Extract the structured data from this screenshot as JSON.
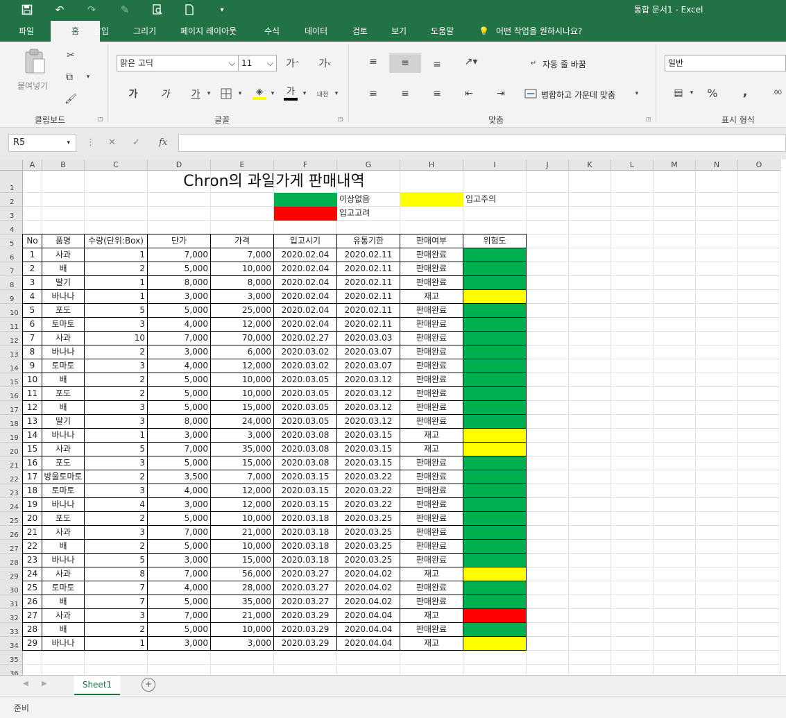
{
  "window": {
    "title": "통합 문서1  -  Excel"
  },
  "tabs": [
    "파일",
    "홈",
    "삽입",
    "그리기",
    "페이지 레이아웃",
    "수식",
    "데이터",
    "검토",
    "보기",
    "도움말"
  ],
  "tell_me": "어떤 작업을 원하시나요?",
  "ribbon": {
    "paste_label": "붙여넣기",
    "clipboard_group": "클립보드",
    "font_name": "맑은 고딕",
    "font_size": "11",
    "font_group": "글꼴",
    "wrap_text": "자동 줄 바꿈",
    "merge_center": "병합하고 가운데 맞춤",
    "align_group": "맞춤",
    "number_format": "일반",
    "number_group": "표시 형식",
    "bold_glyph": "가",
    "italic_glyph": "가",
    "underline_glyph": "가",
    "grow_glyph": "가",
    "shrink_glyph": "가",
    "phonetic_glyph": "내천",
    "font_color_glyph": "가",
    "percent_glyph": "%",
    "comma_glyph": ","
  },
  "formula_bar": {
    "name_box": "R5",
    "fx": "fx",
    "formula": ""
  },
  "columns": [
    "A",
    "B",
    "C",
    "D",
    "E",
    "F",
    "G",
    "H",
    "I",
    "J",
    "K",
    "L",
    "M",
    "N",
    "O"
  ],
  "rows_visible": 36,
  "sheet": {
    "title": "Chron의 과일가게 판매내역",
    "legend": {
      "ok_label": "이상없음",
      "caution_label": "입고주의",
      "consider_label": "입고고려",
      "ok_color": "#00b050",
      "caution_color": "#ffff00",
      "consider_color": "#ff0000"
    },
    "headers": [
      "No",
      "품명",
      "수량(단위:Box)",
      "단가",
      "가격",
      "입고시기",
      "유통기한",
      "판매여부",
      "위험도"
    ],
    "rows": [
      [
        "1",
        "사과",
        "1",
        "7,000",
        "7,000",
        "2020.02.04",
        "2020.02.11",
        "판매완료",
        "green"
      ],
      [
        "2",
        "배",
        "2",
        "5,000",
        "10,000",
        "2020.02.04",
        "2020.02.11",
        "판매완료",
        "green"
      ],
      [
        "3",
        "딸기",
        "1",
        "8,000",
        "8,000",
        "2020.02.04",
        "2020.02.11",
        "판매완료",
        "green"
      ],
      [
        "4",
        "바나나",
        "1",
        "3,000",
        "3,000",
        "2020.02.04",
        "2020.02.11",
        "재고",
        "yellow"
      ],
      [
        "5",
        "포도",
        "5",
        "5,000",
        "25,000",
        "2020.02.04",
        "2020.02.11",
        "판매완료",
        "green"
      ],
      [
        "6",
        "토마토",
        "3",
        "4,000",
        "12,000",
        "2020.02.04",
        "2020.02.11",
        "판매완료",
        "green"
      ],
      [
        "7",
        "사과",
        "10",
        "7,000",
        "70,000",
        "2020.02.27",
        "2020.03.03",
        "판매완료",
        "green"
      ],
      [
        "8",
        "바나나",
        "2",
        "3,000",
        "6,000",
        "2020.03.02",
        "2020.03.07",
        "판매완료",
        "green"
      ],
      [
        "9",
        "토마토",
        "3",
        "4,000",
        "12,000",
        "2020.03.02",
        "2020.03.07",
        "판매완료",
        "green"
      ],
      [
        "10",
        "배",
        "2",
        "5,000",
        "10,000",
        "2020.03.05",
        "2020.03.12",
        "판매완료",
        "green"
      ],
      [
        "11",
        "포도",
        "2",
        "5,000",
        "10,000",
        "2020.03.05",
        "2020.03.12",
        "판매완료",
        "green"
      ],
      [
        "12",
        "배",
        "3",
        "5,000",
        "15,000",
        "2020.03.05",
        "2020.03.12",
        "판매완료",
        "green"
      ],
      [
        "13",
        "딸기",
        "3",
        "8,000",
        "24,000",
        "2020.03.05",
        "2020.03.12",
        "판매완료",
        "green"
      ],
      [
        "14",
        "바나나",
        "1",
        "3,000",
        "3,000",
        "2020.03.08",
        "2020.03.15",
        "재고",
        "yellow"
      ],
      [
        "15",
        "사과",
        "5",
        "7,000",
        "35,000",
        "2020.03.08",
        "2020.03.15",
        "재고",
        "yellow"
      ],
      [
        "16",
        "포도",
        "3",
        "5,000",
        "15,000",
        "2020.03.08",
        "2020.03.15",
        "판매완료",
        "green"
      ],
      [
        "17",
        "방울토마토",
        "2",
        "3,500",
        "7,000",
        "2020.03.15",
        "2020.03.22",
        "판매완료",
        "green"
      ],
      [
        "18",
        "토마토",
        "3",
        "4,000",
        "12,000",
        "2020.03.15",
        "2020.03.22",
        "판매완료",
        "green"
      ],
      [
        "19",
        "바나나",
        "4",
        "3,000",
        "12,000",
        "2020.03.15",
        "2020.03.22",
        "판매완료",
        "green"
      ],
      [
        "20",
        "포도",
        "2",
        "5,000",
        "10,000",
        "2020.03.18",
        "2020.03.25",
        "판매완료",
        "green"
      ],
      [
        "21",
        "사과",
        "3",
        "7,000",
        "21,000",
        "2020.03.18",
        "2020.03.25",
        "판매완료",
        "green"
      ],
      [
        "22",
        "배",
        "2",
        "5,000",
        "10,000",
        "2020.03.18",
        "2020.03.25",
        "판매완료",
        "green"
      ],
      [
        "23",
        "바나나",
        "5",
        "3,000",
        "15,000",
        "2020.03.18",
        "2020.03.25",
        "판매완료",
        "green"
      ],
      [
        "24",
        "사과",
        "8",
        "7,000",
        "56,000",
        "2020.03.27",
        "2020.04.02",
        "재고",
        "yellow"
      ],
      [
        "25",
        "토마토",
        "7",
        "4,000",
        "28,000",
        "2020.03.27",
        "2020.04.02",
        "판매완료",
        "green"
      ],
      [
        "26",
        "배",
        "7",
        "5,000",
        "35,000",
        "2020.03.27",
        "2020.04.02",
        "판매완료",
        "green"
      ],
      [
        "27",
        "사과",
        "3",
        "7,000",
        "21,000",
        "2020.03.29",
        "2020.04.04",
        "재고",
        "red"
      ],
      [
        "28",
        "배",
        "2",
        "5,000",
        "10,000",
        "2020.03.29",
        "2020.04.04",
        "판매완료",
        "green"
      ],
      [
        "29",
        "바나나",
        "1",
        "3,000",
        "3,000",
        "2020.03.29",
        "2020.04.04",
        "재고",
        "yellow"
      ]
    ]
  },
  "sheet_tabs": [
    "Sheet1"
  ],
  "status": "준비",
  "colors": {
    "accent": "#217346"
  }
}
